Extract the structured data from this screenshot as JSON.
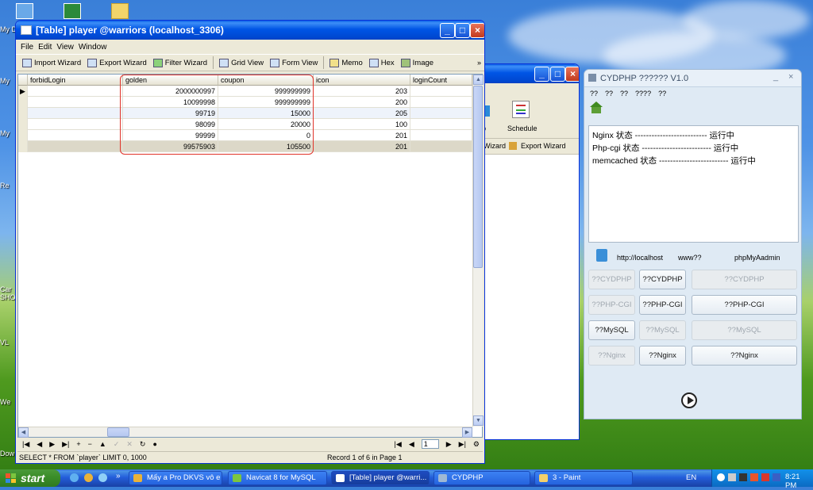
{
  "desktop": {
    "icon_labels": [
      "My D",
      "My",
      "My",
      "Re",
      "Car SHO",
      "VL",
      "We",
      "Dow"
    ]
  },
  "navicat_table": {
    "title": "[Table] player @warriors (localhost_3306)",
    "menu": [
      "File",
      "Edit",
      "View",
      "Window"
    ],
    "toolbar": [
      "Import Wizard",
      "Export Wizard",
      "Filter Wizard",
      "Grid View",
      "Form View",
      "Memo",
      "Hex",
      "Image"
    ],
    "columns": [
      "forbidLogin",
      "golden",
      "coupon",
      "icon",
      "loginCount"
    ],
    "rows": [
      {
        "forbidLogin": "",
        "golden": "2000000997",
        "coupon": "999999999",
        "icon": "203",
        "loginCount": ""
      },
      {
        "forbidLogin": "",
        "golden": "10099998",
        "coupon": "999999999",
        "icon": "200",
        "loginCount": ""
      },
      {
        "forbidLogin": "",
        "golden": "99719",
        "coupon": "15000",
        "icon": "205",
        "loginCount": ""
      },
      {
        "forbidLogin": "",
        "golden": "98099",
        "coupon": "20000",
        "icon": "100",
        "loginCount": ""
      },
      {
        "forbidLogin": "",
        "golden": "99999",
        "coupon": "0",
        "icon": "201",
        "loginCount": ""
      },
      {
        "forbidLogin": "",
        "golden": "99575903",
        "coupon": "105500",
        "icon": "201",
        "loginCount": ""
      }
    ],
    "nav_page": "1",
    "query": "SELECT * FROM `player` LIMIT 0, 1000",
    "record_info": "Record 1 of 6 in Page 1"
  },
  "navicat_main": {
    "schedule_label": "Schedule",
    "partial_p": "p",
    "partial_wizard": "Wizard",
    "export_wizard": "Export Wizard"
  },
  "cydphp": {
    "title": "CYDPHP  ??????  V1.0",
    "menu": [
      "??",
      "??",
      "??",
      "????",
      "??"
    ],
    "status_lines": [
      "Nginx 状态 -------------------------- 运行中",
      "Php-cgi 状态 ------------------------- 运行中",
      "memcached 状态 ------------------------- 运行中"
    ],
    "links": [
      "http://localhost",
      "www??",
      "phpMyAadmin"
    ],
    "buttons": [
      [
        "??CYDPHP",
        "??CYDPHP",
        "??CYDPHP"
      ],
      [
        "??PHP-CGI",
        "??PHP-CGI",
        "??PHP-CGI"
      ],
      [
        "??MySQL",
        "??MySQL",
        "??MySQL"
      ],
      [
        "??Nginx",
        "??Nginx",
        "??Nginx"
      ]
    ]
  },
  "taskbar": {
    "start": "start",
    "tasks": [
      "Mấy a Pro DKVS vô e ...",
      "Navicat 8 for MySQL",
      "[Table] player @warri...",
      "CYDPHP",
      "3 - Paint"
    ],
    "lang": "EN",
    "clock": "8:21 PM"
  }
}
